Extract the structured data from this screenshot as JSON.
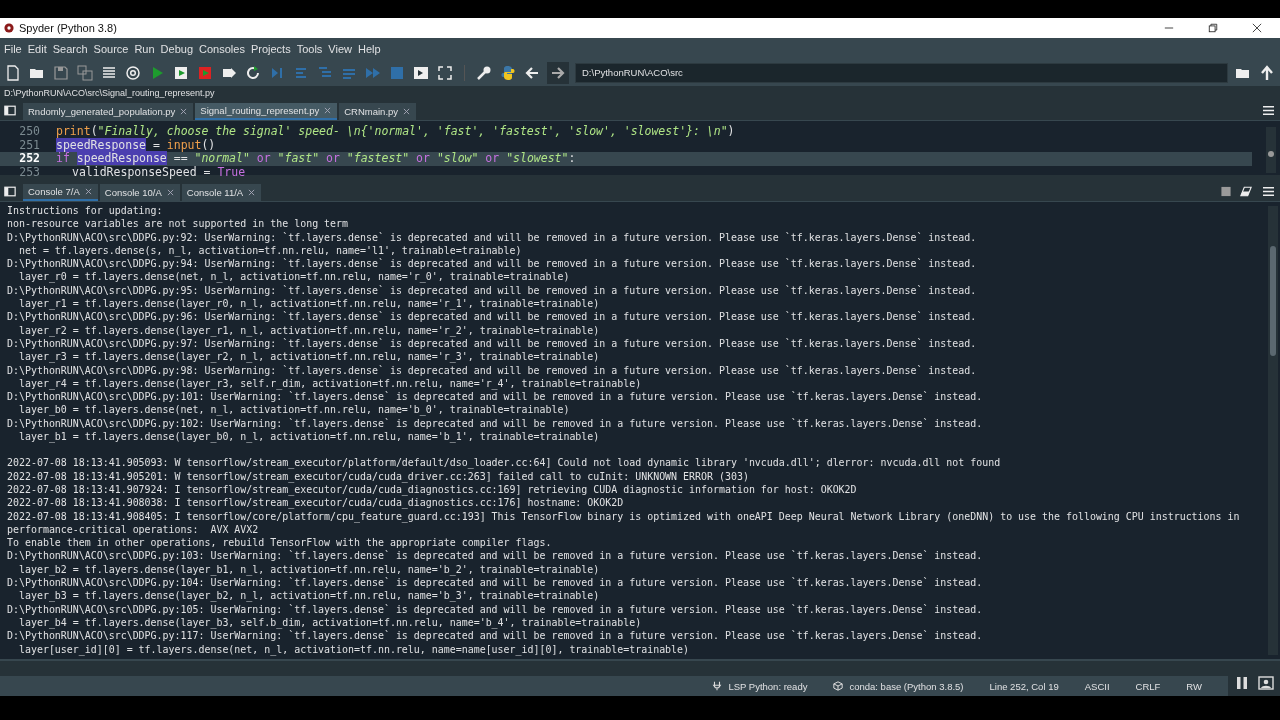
{
  "window": {
    "title": "Spyder (Python 3.8)"
  },
  "menu": [
    "File",
    "Edit",
    "Search",
    "Source",
    "Run",
    "Debug",
    "Consoles",
    "Projects",
    "Tools",
    "View",
    "Help"
  ],
  "toolbar": {
    "directory": "D:\\PythonRUN\\ACO\\src"
  },
  "file_path": "D:\\PythonRUN\\ACO\\src\\Signal_routing_represent.py",
  "editor_tabs": [
    {
      "label": "Rndomly_generated_population.py",
      "selected": false
    },
    {
      "label": "Signal_routing_represent.py",
      "selected": true
    },
    {
      "label": "CRNmain.py",
      "selected": false
    }
  ],
  "editor": {
    "lines": [
      {
        "number": "250",
        "current": false,
        "tokens": [
          {
            "text": "print",
            "kind": "builtin"
          },
          {
            "text": "(",
            "kind": "plain"
          },
          {
            "text": "\"Finally, choose the signal' speed- \\n{'normal', 'fast', 'fastest', 'slow', 'slowest'}: \\n\"",
            "kind": "string"
          },
          {
            "text": ")",
            "kind": "plain"
          }
        ]
      },
      {
        "number": "251",
        "current": false,
        "tokens": [
          {
            "text": "speedResponse",
            "kind": "occurrence"
          },
          {
            "text": " = ",
            "kind": "plain"
          },
          {
            "text": "input",
            "kind": "builtin"
          },
          {
            "text": "()",
            "kind": "plain"
          }
        ]
      },
      {
        "number": "252",
        "current": true,
        "tokens": [
          {
            "text": "if ",
            "kind": "keyword"
          },
          {
            "text": "speedResponse",
            "kind": "occurrence"
          },
          {
            "text": " == ",
            "kind": "plain"
          },
          {
            "text": "\"normal\" ",
            "kind": "string"
          },
          {
            "text": "or ",
            "kind": "keyword"
          },
          {
            "text": "\"fast\" ",
            "kind": "string"
          },
          {
            "text": "or ",
            "kind": "keyword"
          },
          {
            "text": "\"fastest\" ",
            "kind": "string"
          },
          {
            "text": "or ",
            "kind": "keyword"
          },
          {
            "text": "\"slow\" ",
            "kind": "string"
          },
          {
            "text": "or ",
            "kind": "keyword"
          },
          {
            "text": "\"slowest\"",
            "kind": "string"
          },
          {
            "text": ":",
            "kind": "plain"
          }
        ],
        "children": [
          {
            "number": "253",
            "current": false,
            "tokens": [
              {
                "text": "validResponseSpeed = ",
                "kind": "plain"
              },
              {
                "text": "True",
                "kind": "keyword"
              }
            ]
          }
        ]
      }
    ]
  },
  "console_tabs": [
    {
      "label": "Console 7/A",
      "selected": true
    },
    {
      "label": "Console 10/A",
      "selected": false
    },
    {
      "label": "Console 11/A",
      "selected": false
    }
  ],
  "console": {
    "blocks": [
      [
        "Instructions for updating:",
        "non-resource variables are not supported in the long term",
        "D:\\PythonRUN\\ACO\\src\\DDPG.py:92: UserWarning: `tf.layers.dense` is deprecated and will be removed in a future version. Please use `tf.keras.layers.Dense` instead.",
        "  net = tf.layers.dense(s, n_l, activation=tf.nn.relu, name='l1', trainable=trainable)",
        "D:\\PythonRUN\\ACO\\src\\DDPG.py:94: UserWarning: `tf.layers.dense` is deprecated and will be removed in a future version. Please use `tf.keras.layers.Dense` instead.",
        "  layer_r0 = tf.layers.dense(net, n_l, activation=tf.nn.relu, name='r_0', trainable=trainable)",
        "D:\\PythonRUN\\ACO\\src\\DDPG.py:95: UserWarning: `tf.layers.dense` is deprecated and will be removed in a future version. Please use `tf.keras.layers.Dense` instead.",
        "  layer_r1 = tf.layers.dense(layer_r0, n_l, activation=tf.nn.relu, name='r_1', trainable=trainable)",
        "D:\\PythonRUN\\ACO\\src\\DDPG.py:96: UserWarning: `tf.layers.dense` is deprecated and will be removed in a future version. Please use `tf.keras.layers.Dense` instead.",
        "  layer_r2 = tf.layers.dense(layer_r1, n_l, activation=tf.nn.relu, name='r_2', trainable=trainable)",
        "D:\\PythonRUN\\ACO\\src\\DDPG.py:97: UserWarning: `tf.layers.dense` is deprecated and will be removed in a future version. Please use `tf.keras.layers.Dense` instead.",
        "  layer_r3 = tf.layers.dense(layer_r2, n_l, activation=tf.nn.relu, name='r_3', trainable=trainable)",
        "D:\\PythonRUN\\ACO\\src\\DDPG.py:98: UserWarning: `tf.layers.dense` is deprecated and will be removed in a future version. Please use `tf.keras.layers.Dense` instead.",
        "  layer_r4 = tf.layers.dense(layer_r3, self.r_dim, activation=tf.nn.relu, name='r_4', trainable=trainable)",
        "D:\\PythonRUN\\ACO\\src\\DDPG.py:101: UserWarning: `tf.layers.dense` is deprecated and will be removed in a future version. Please use `tf.keras.layers.Dense` instead.",
        "  layer_b0 = tf.layers.dense(net, n_l, activation=tf.nn.relu, name='b_0', trainable=trainable)",
        "D:\\PythonRUN\\ACO\\src\\DDPG.py:102: UserWarning: `tf.layers.dense` is deprecated and will be removed in a future version. Please use `tf.keras.layers.Dense` instead.",
        "  layer_b1 = tf.layers.dense(layer_b0, n_l, activation=tf.nn.relu, name='b_1', trainable=trainable)"
      ],
      [
        "2022-07-08 18:13:41.905093: W tensorflow/stream_executor/platform/default/dso_loader.cc:64] Could not load dynamic library 'nvcuda.dll'; dlerror: nvcuda.dll not found",
        "2022-07-08 18:13:41.905201: W tensorflow/stream_executor/cuda/cuda_driver.cc:263] failed call to cuInit: UNKNOWN ERROR (303)",
        "2022-07-08 18:13:41.907924: I tensorflow/stream_executor/cuda/cuda_diagnostics.cc:169] retrieving CUDA diagnostic information for host: OKOK2D",
        "2022-07-08 18:13:41.908038: I tensorflow/stream_executor/cuda/cuda_diagnostics.cc:176] hostname: OKOK2D",
        "2022-07-08 18:13:41.908405: I tensorflow/core/platform/cpu_feature_guard.cc:193] This TensorFlow binary is optimized with oneAPI Deep Neural Network Library (oneDNN) to use the following CPU instructions in",
        "performance-critical operations:  AVX AVX2",
        "To enable them in other operations, rebuild TensorFlow with the appropriate compiler flags.",
        "D:\\PythonRUN\\ACO\\src\\DDPG.py:103: UserWarning: `tf.layers.dense` is deprecated and will be removed in a future version. Please use `tf.keras.layers.Dense` instead.",
        "  layer_b2 = tf.layers.dense(layer_b1, n_l, activation=tf.nn.relu, name='b_2', trainable=trainable)",
        "D:\\PythonRUN\\ACO\\src\\DDPG.py:104: UserWarning: `tf.layers.dense` is deprecated and will be removed in a future version. Please use `tf.keras.layers.Dense` instead.",
        "  layer_b3 = tf.layers.dense(layer_b2, n_l, activation=tf.nn.relu, name='b_3', trainable=trainable)",
        "D:\\PythonRUN\\ACO\\src\\DDPG.py:105: UserWarning: `tf.layers.dense` is deprecated and will be removed in a future version. Please use `tf.keras.layers.Dense` instead.",
        "  layer_b4 = tf.layers.dense(layer_b3, self.b_dim, activation=tf.nn.relu, name='b_4', trainable=trainable)",
        "D:\\PythonRUN\\ACO\\src\\DDPG.py:117: UserWarning: `tf.layers.dense` is deprecated and will be removed in a future version. Please use `tf.keras.layers.Dense` instead.",
        "  layer[user_id][0] = tf.layers.dense(net, n_l, activation=tf.nn.relu, name=name[user_id][0], trainable=trainable)"
      ]
    ]
  },
  "status_bar": {
    "lsp": "LSP Python: ready",
    "conda": "conda: base (Python 3.8.5)",
    "position": "Line 252, Col 19",
    "encoding": "ASCII",
    "eol": "CRLF",
    "mode": "RW"
  }
}
